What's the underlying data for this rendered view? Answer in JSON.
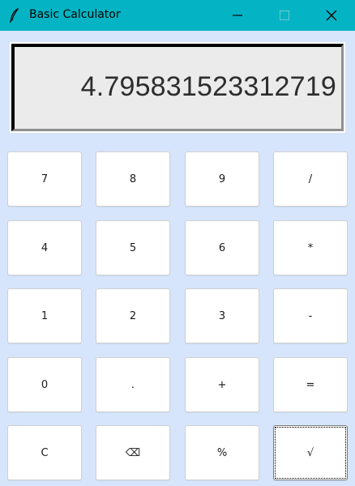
{
  "window": {
    "title": "Basic Calculator",
    "titlebar_color": "#04b4c4",
    "background_color": "#d6e5fb",
    "icons": [
      "feather-icon",
      "minimize-icon",
      "maximize-icon",
      "close-icon"
    ]
  },
  "display": {
    "value": "4.795831523312719"
  },
  "keys": [
    {
      "label": "7"
    },
    {
      "label": "8"
    },
    {
      "label": "9"
    },
    {
      "label": "/"
    },
    {
      "label": "4"
    },
    {
      "label": "5"
    },
    {
      "label": "6"
    },
    {
      "label": "*"
    },
    {
      "label": "1"
    },
    {
      "label": "2"
    },
    {
      "label": "3"
    },
    {
      "label": "-"
    },
    {
      "label": "0"
    },
    {
      "label": "."
    },
    {
      "label": "+"
    },
    {
      "label": "="
    },
    {
      "label": "C"
    },
    {
      "label": "⌫"
    },
    {
      "label": "%"
    },
    {
      "label": "√"
    }
  ],
  "focused_key": "√"
}
